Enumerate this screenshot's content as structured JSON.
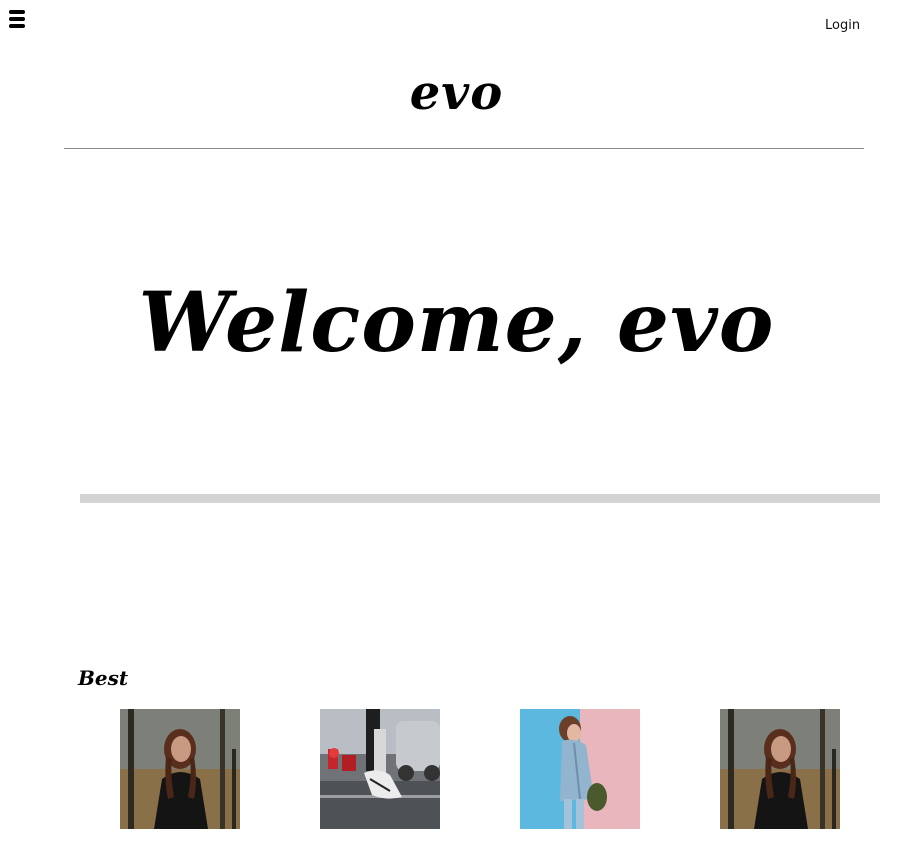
{
  "header": {
    "menu_icon": "hamburger-menu-icon",
    "login_label": "Login",
    "brand": "evo"
  },
  "hero": {
    "title": "Welcome, evo"
  },
  "best": {
    "title": "Best",
    "products": [
      {
        "image": "woman-in-black-sweater-forest-photo"
      },
      {
        "image": "white-sneakers-street-photo"
      },
      {
        "image": "woman-denim-jacket-pink-blue-wall-photo"
      },
      {
        "image": "woman-in-black-sweater-forest-photo"
      }
    ]
  },
  "colors": {
    "divider": "#8c8c8c",
    "hero_bar": "#d3d3d3",
    "text": "#000000"
  }
}
